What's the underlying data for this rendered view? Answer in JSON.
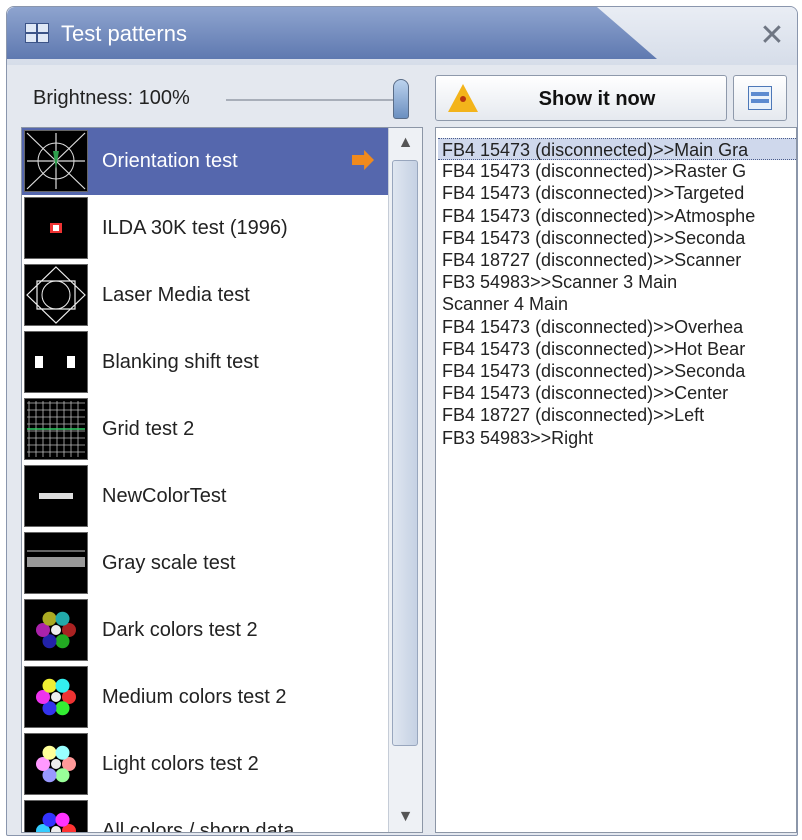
{
  "window": {
    "title": "Test patterns",
    "close_symbol": "✕",
    "icons": {
      "app": "grid-window-icon",
      "close": "close-icon"
    }
  },
  "brightness": {
    "label": "Brightness: 100%",
    "value": 1.0
  },
  "show_button": {
    "label": "Show it now",
    "icon": "laser-warning-icon"
  },
  "options_button": {
    "icon": "list-view-icon"
  },
  "patterns": [
    {
      "label": "Orientation test",
      "selected": true,
      "thumb": "orientation"
    },
    {
      "label": "ILDA 30K test (1996)",
      "selected": false,
      "thumb": "ilda"
    },
    {
      "label": "Laser Media test",
      "selected": false,
      "thumb": "lasermedia"
    },
    {
      "label": "Blanking shift test",
      "selected": false,
      "thumb": "blanking"
    },
    {
      "label": "Grid test 2",
      "selected": false,
      "thumb": "grid"
    },
    {
      "label": "NewColorTest",
      "selected": false,
      "thumb": "newcolor"
    },
    {
      "label": "Gray scale test",
      "selected": false,
      "thumb": "grayscale"
    },
    {
      "label": "Dark colors test 2",
      "selected": false,
      "thumb": "colorwheel-dark"
    },
    {
      "label": "Medium colors test 2",
      "selected": false,
      "thumb": "colorwheel-medium"
    },
    {
      "label": "Light colors test 2",
      "selected": false,
      "thumb": "colorwheel-light"
    },
    {
      "label": "All colors / shorp data",
      "selected": false,
      "thumb": "allcolors"
    }
  ],
  "scrollbar": {
    "up": "▲",
    "down": "▼"
  },
  "targets": [
    {
      "label": "FB4 15473 (disconnected)>>Main Gra",
      "selected": true
    },
    {
      "label": "FB4 15473 (disconnected)>>Raster G",
      "selected": false
    },
    {
      "label": "FB4 15473 (disconnected)>>Targeted",
      "selected": false
    },
    {
      "label": "FB4 15473 (disconnected)>>Atmosphe",
      "selected": false
    },
    {
      "label": "FB4 15473 (disconnected)>>Seconda",
      "selected": false
    },
    {
      "label": "FB4 18727 (disconnected)>>Scanner",
      "selected": false
    },
    {
      "label": "FB3 54983>>Scanner 3 Main",
      "selected": false
    },
    {
      "label": "Scanner 4 Main",
      "selected": false
    },
    {
      "label": "FB4 15473 (disconnected)>>Overhea",
      "selected": false
    },
    {
      "label": "FB4 15473 (disconnected)>>Hot Bear",
      "selected": false
    },
    {
      "label": "FB4 15473 (disconnected)>>Seconda",
      "selected": false
    },
    {
      "label": "FB4 15473 (disconnected)>>Center",
      "selected": false
    },
    {
      "label": "FB4 18727 (disconnected)>>Left",
      "selected": false
    },
    {
      "label": "FB3 54983>>Right",
      "selected": false
    }
  ]
}
